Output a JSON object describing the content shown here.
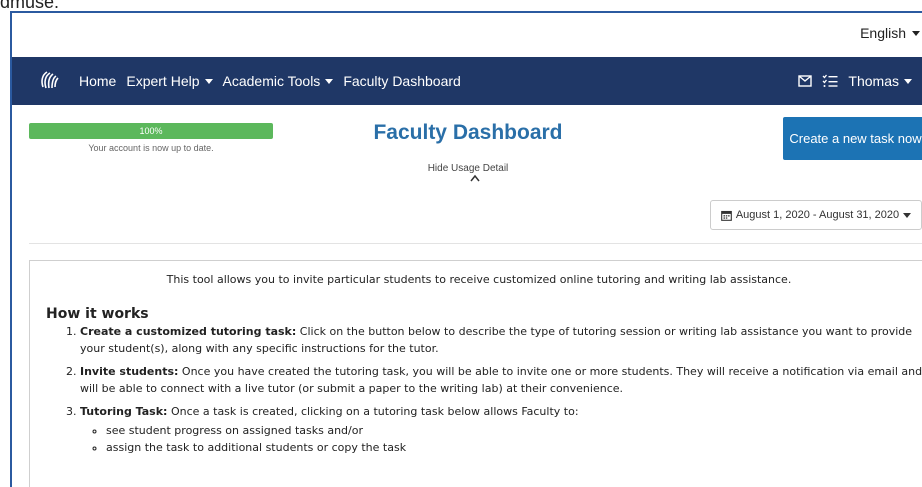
{
  "top_cut_text": "dmuse.",
  "language": {
    "label": "English"
  },
  "nav": {
    "items": [
      {
        "label": "Home",
        "has_caret": false
      },
      {
        "label": "Expert Help",
        "has_caret": true
      },
      {
        "label": "Academic Tools",
        "has_caret": true
      },
      {
        "label": "Faculty Dashboard",
        "has_caret": false
      }
    ],
    "user": "Thomas",
    "icons": [
      "logo-icon",
      "mail-icon",
      "tasks-icon"
    ]
  },
  "progress": {
    "label": "100%",
    "value": 1.0,
    "note": "Your account is now up to date.",
    "color": "#5cb85c"
  },
  "page_title": "Faculty Dashboard",
  "hide_usage": "Hide Usage Detail",
  "create_button": "Create a new task now",
  "date_range": "August 1, 2020 - August 31, 2020",
  "info": {
    "intro": "This tool allows you to invite particular students to receive customized online tutoring and writing lab assistance.",
    "how_title": "How it works",
    "steps": [
      {
        "title": "Create a customized tutoring task:",
        "text": "Click on the button below to describe the type of tutoring session or writing lab assistance you want to provide your student(s), along with any specific instructions for the tutor."
      },
      {
        "title": "Invite students:",
        "text": "Once you have created the tutoring task, you will be able to invite one or more students. They will receive a notification via email and will be able to connect with a live tutor (or submit a paper to the writing lab) at their convenience."
      },
      {
        "title": "Tutoring Task:",
        "text": "Once a task is created, clicking on a tutoring task below allows Faculty to:"
      }
    ],
    "sub_items": [
      "see student progress on assigned tasks and/or",
      "assign the task to additional students or copy the task"
    ]
  },
  "colors": {
    "navbar": "#1f3766",
    "accent": "#1c73b4",
    "title": "#2a6fa8"
  }
}
